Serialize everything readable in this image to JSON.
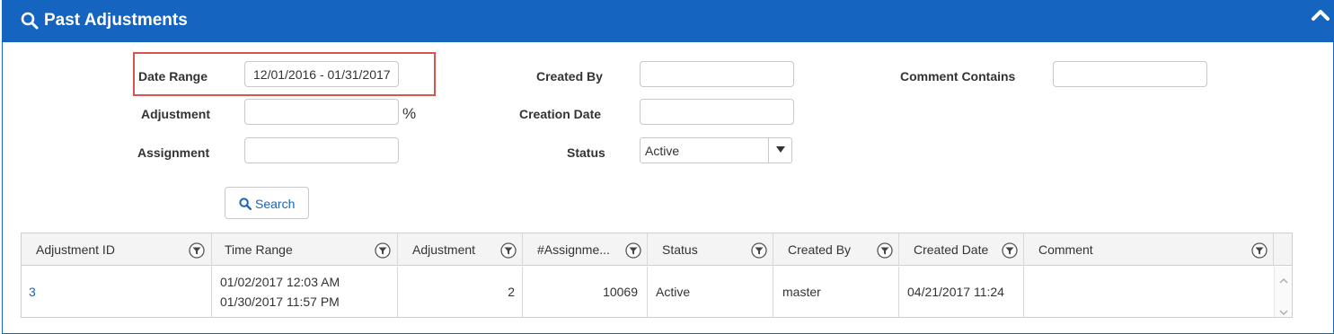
{
  "panel": {
    "title": "Past Adjustments",
    "icons": {
      "title": "search-icon",
      "collapse": "chevron-up-icon"
    },
    "colors": {
      "header_bg": "#1565c0",
      "highlight_border": "#d9534f",
      "link": "#1565c0"
    }
  },
  "form": {
    "date_range": {
      "label": "Date Range",
      "value": "12/01/2016 - 01/31/2017"
    },
    "adjustment": {
      "label": "Adjustment",
      "value": "",
      "suffix": "%"
    },
    "assignment": {
      "label": "Assignment",
      "value": ""
    },
    "created_by": {
      "label": "Created By",
      "value": ""
    },
    "creation_date": {
      "label": "Creation Date",
      "value": ""
    },
    "status": {
      "label": "Status",
      "selected": "Active"
    },
    "comment_contains": {
      "label": "Comment Contains",
      "value": ""
    },
    "search_button": {
      "label": "Search",
      "icon": "search-icon"
    }
  },
  "grid": {
    "columns": [
      {
        "label": "Adjustment ID"
      },
      {
        "label": "Time Range"
      },
      {
        "label": "Adjustment"
      },
      {
        "label": "#Assignme..."
      },
      {
        "label": "Status"
      },
      {
        "label": "Created By"
      },
      {
        "label": "Created Date"
      },
      {
        "label": "Comment"
      }
    ],
    "filter_icon": "filter-icon",
    "rows": [
      {
        "adjustment_id": "3",
        "time_range_start": "01/02/2017 12:03 AM",
        "time_range_end": "01/30/2017 11:57 PM",
        "adjustment": "2",
        "assignments": "10069",
        "status": "Active",
        "created_by": "master",
        "created_date": "04/21/2017 11:24",
        "comment": ""
      }
    ]
  }
}
